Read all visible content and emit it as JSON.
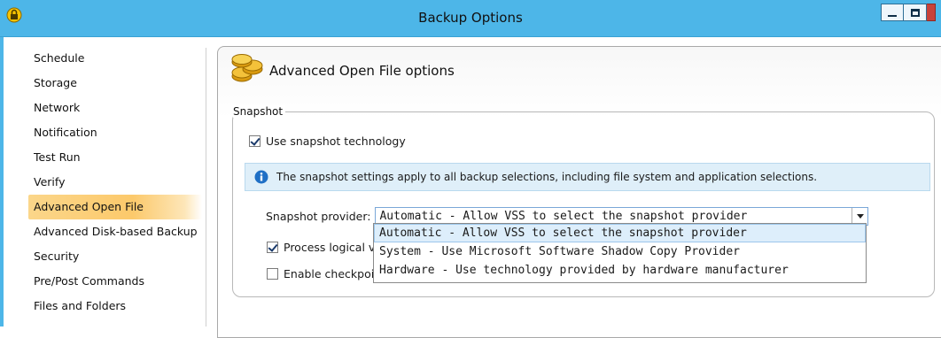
{
  "window": {
    "title": "Backup Options",
    "accent": "#4db6e8"
  },
  "sidebar": {
    "items": [
      {
        "label": "Schedule",
        "active": false
      },
      {
        "label": "Storage",
        "active": false
      },
      {
        "label": "Network",
        "active": false
      },
      {
        "label": "Notification",
        "active": false
      },
      {
        "label": "Test Run",
        "active": false
      },
      {
        "label": "Verify",
        "active": false
      },
      {
        "label": "Advanced Open File",
        "active": true
      },
      {
        "label": "Advanced Disk-based Backup",
        "active": false
      },
      {
        "label": "Security",
        "active": false
      },
      {
        "label": "Pre/Post Commands",
        "active": false
      },
      {
        "label": "Files and Folders",
        "active": false
      }
    ]
  },
  "panel": {
    "title": "Advanced Open File options",
    "icon": "coins-icon"
  },
  "snapshot": {
    "group_label": "Snapshot",
    "use_snapshot": {
      "label": "Use snapshot technology",
      "checked": true
    },
    "info_text": "The snapshot settings apply to all backup selections, including file system and application selections.",
    "provider_label": "Snapshot provider:",
    "provider_value": "Automatic - Allow VSS to select the snapshot provider",
    "provider_options": [
      "Automatic - Allow VSS to select the snapshot provider",
      "System - Use Microsoft Software Shadow Copy Provider",
      "Hardware - Use technology provided by hardware manufacturer"
    ],
    "process_logical": {
      "label": "Process logical v",
      "checked": true
    },
    "enable_checkpoint": {
      "label": "Enable checkpoi",
      "checked": false
    }
  }
}
